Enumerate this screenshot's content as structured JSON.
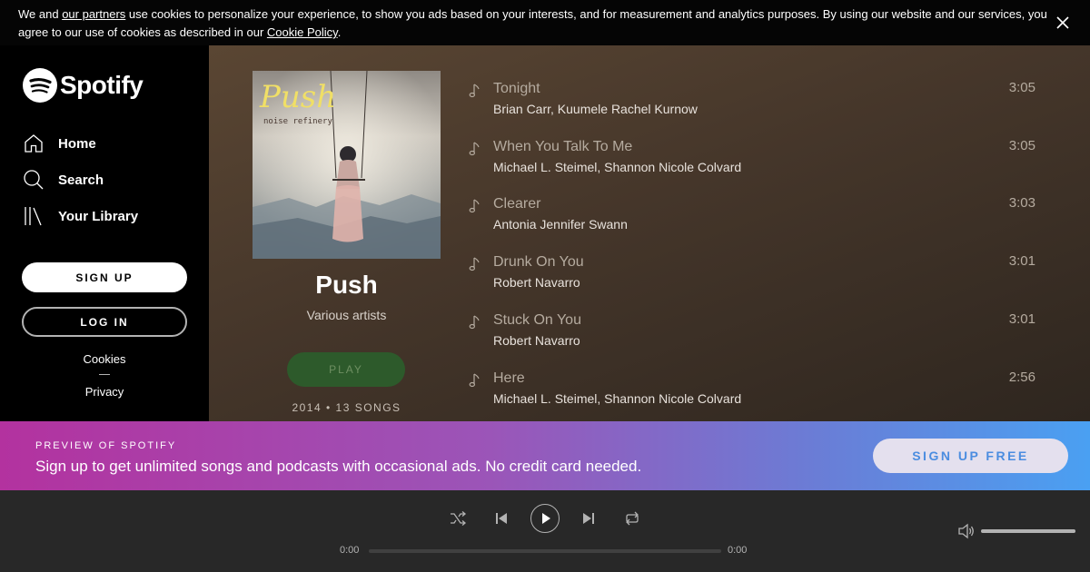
{
  "cookie_banner": {
    "text_1": "We and ",
    "partners_link": "our partners",
    "text_2": " use cookies to personalize your experience, to show you ads based on your interests, and for measurement and analytics purposes. By using our website and our services, you agree to our use of cookies as described in our ",
    "policy_link": "Cookie Policy",
    "text_3": ".",
    "close_icon": "close-icon"
  },
  "sidebar": {
    "logo_text": "Spotify",
    "nav": [
      {
        "label": "Home",
        "icon": "home-icon"
      },
      {
        "label": "Search",
        "icon": "search-icon"
      },
      {
        "label": "Your Library",
        "icon": "library-icon"
      }
    ],
    "signup_label": "SIGN UP",
    "login_label": "LOG IN",
    "cookies_link": "Cookies",
    "privacy_link": "Privacy"
  },
  "album": {
    "cover_title": "Push",
    "cover_subtitle": "noise refinery",
    "title": "Push",
    "artist": "Various artists",
    "play_label": "PLAY",
    "meta": "2014 • 13 SONGS"
  },
  "tracks": [
    {
      "title": "Tonight",
      "artists": "Brian Carr, Kuumele Rachel Kurnow",
      "duration": "3:05"
    },
    {
      "title": "When You Talk To Me",
      "artists": "Michael L. Steimel, Shannon Nicole Colvard",
      "duration": "3:05"
    },
    {
      "title": "Clearer",
      "artists": "Antonia Jennifer Swann",
      "duration": "3:03"
    },
    {
      "title": "Drunk On You",
      "artists": "Robert Navarro",
      "duration": "3:01"
    },
    {
      "title": "Stuck On You",
      "artists": "Robert Navarro",
      "duration": "3:01"
    },
    {
      "title": "Here",
      "artists": "Michael L. Steimel, Shannon Nicole Colvard",
      "duration": "2:56"
    }
  ],
  "preview": {
    "label": "PREVIEW OF SPOTIFY",
    "text": "Sign up to get unlimited songs and podcasts with occasional ads. No credit card needed.",
    "button": "SIGN UP FREE"
  },
  "player": {
    "current_time": "0:00",
    "total_time": "0:00",
    "progress": 0,
    "volume": 1.0,
    "icons": [
      "shuffle-icon",
      "previous-icon",
      "play-icon",
      "next-icon",
      "repeat-icon",
      "volume-icon"
    ]
  },
  "colors": {
    "accent_green": "#1db954",
    "preview_gradient_start": "#b3329f",
    "preview_gradient_end": "#4aa0f2"
  }
}
